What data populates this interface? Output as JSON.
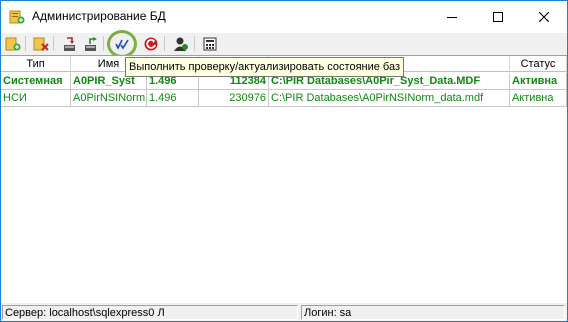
{
  "window": {
    "title": "Администрирование БД"
  },
  "toolbar": {
    "buttons": [
      {
        "icon": "add-database-icon"
      },
      {
        "icon": "delete-database-icon"
      },
      {
        "icon": "detach-database-icon"
      },
      {
        "icon": "attach-database-icon"
      },
      {
        "icon": "check-database-icon"
      },
      {
        "icon": "refresh-icon"
      },
      {
        "icon": "user-icon"
      },
      {
        "icon": "calculator-icon"
      }
    ],
    "tooltip": "Выполнить проверку/актуализировать состояние баз"
  },
  "table": {
    "columns": [
      "Тип",
      "Имя",
      "",
      "",
      "",
      "Статус"
    ],
    "rows": [
      {
        "type": "Системная",
        "name": "A0PIR_Syst",
        "version": "1.496",
        "size": "112384",
        "path": "C:\\PIR Databases\\A0Pir_Syst_Data.MDF",
        "status": "Активна"
      },
      {
        "type": "НСИ",
        "name": "A0PirNSINorm",
        "version": "1.496",
        "size": "230976",
        "path": "C:\\PIR Databases\\A0PirNSINorm_data.mdf",
        "status": "Активна"
      }
    ]
  },
  "statusbar": {
    "server": "Сервер: localhost\\sqlexpress0 Л",
    "login": "Логин: sa"
  },
  "colors": {
    "accent": "#1883d7",
    "active_text": "#118811",
    "highlight_ring": "#79b041",
    "tooltip_bg": "#ffffe1"
  }
}
